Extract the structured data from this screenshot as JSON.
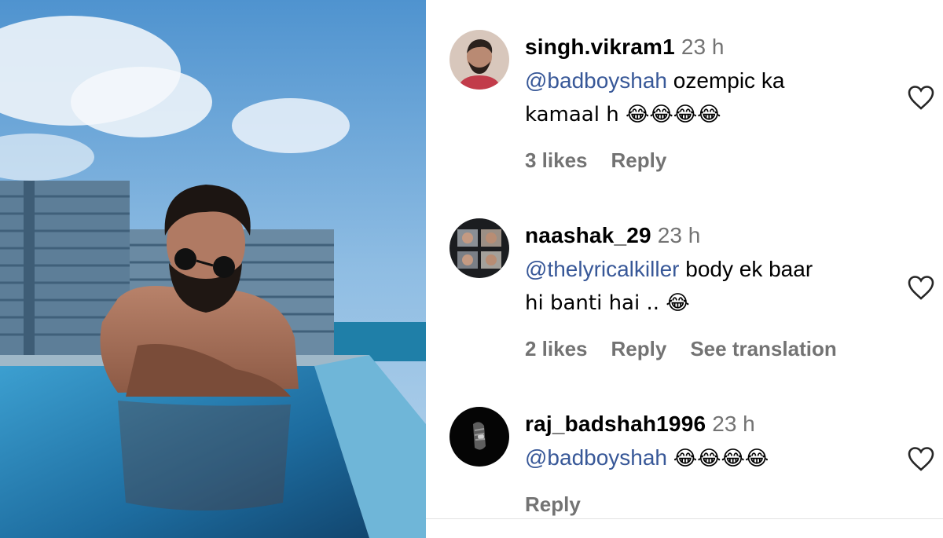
{
  "photo": {
    "alt_subject": "man in pool"
  },
  "comments": [
    {
      "username": "singh.vikram1",
      "time": "23 h",
      "mention": "@badboyshah",
      "text_lines": [
        "ozempic ka",
        "kamaal h 😂😂😂😂"
      ],
      "likes": "3 likes",
      "reply": "Reply",
      "translation": ""
    },
    {
      "username": "naashak_29",
      "time": "23 h",
      "mention": "@thelyricalkiller",
      "text_lines": [
        "body ek baar",
        "hi banti hai .. 😂"
      ],
      "likes": "2 likes",
      "reply": "Reply",
      "translation": "See translation"
    },
    {
      "username": "raj_badshah1996",
      "time": "23 h",
      "mention": "@badboyshah",
      "text_lines": [
        "😂😂😂😂"
      ],
      "likes": "",
      "reply": "Reply",
      "translation": ""
    }
  ],
  "colors": {
    "mention": "#385898",
    "muted": "#737373",
    "pool": "#2a7fb3",
    "sky": "#9cc4e4"
  },
  "icons": [
    "heart-icon"
  ]
}
